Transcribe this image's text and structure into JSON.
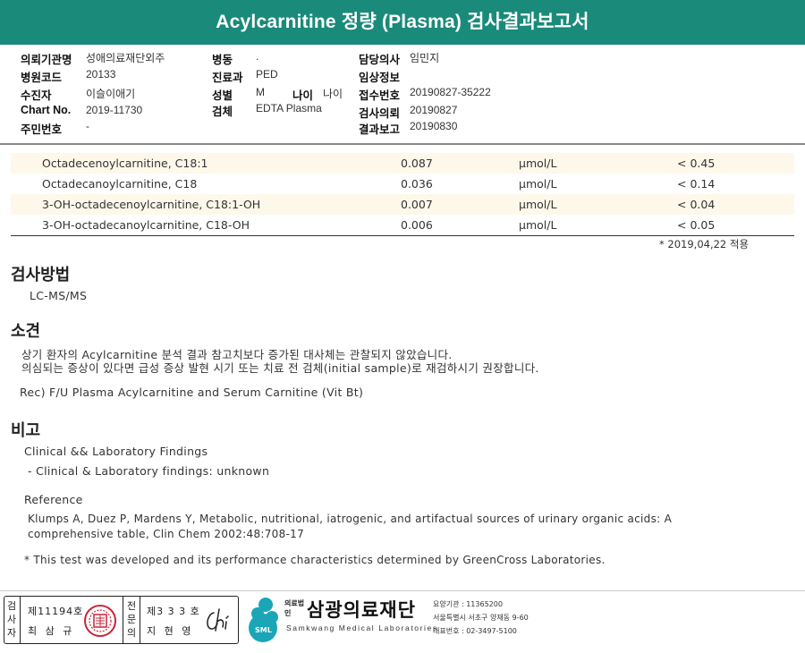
{
  "header": {
    "title": "Acylcarnitine 정량 (Plasma) 검사결과보고서"
  },
  "patient_info": {
    "institution_label": "의뢰기관명",
    "institution": "성애의료재단외주",
    "hospital_code_label": "병원코드",
    "hospital_code": "20133",
    "examinee_label": "수진자",
    "examinee": "이슬이애기",
    "chart_no_label": "Chart No.",
    "chart_no": "2019-11730",
    "resident_no_label": "주민번호",
    "resident_no": "-",
    "ward_label": "병동",
    "ward": ".",
    "department_label": "진료과",
    "department": "PED",
    "sex_label": "성별",
    "sex": "M",
    "age_label": "나이",
    "age": "나이",
    "specimen_label": "검체",
    "specimen": "EDTA Plasma",
    "doctor_label": "담당의사",
    "doctor": "임민지",
    "clinical_info_label": "임상정보",
    "receipt_no_label": "접수번호",
    "receipt_no": "20190827-35222",
    "request_date_label": "검사의뢰",
    "request_date": "20190827",
    "report_date_label": "결과보고",
    "report_date": "20190830"
  },
  "results": [
    {
      "name": "Octadecenoylcarnitine, C18:1",
      "value": "0.087",
      "unit": "μmol/L",
      "reference": "< 0.45"
    },
    {
      "name": "Octadecanoylcarnitine, C18",
      "value": "0.036",
      "unit": "μmol/L",
      "reference": "< 0.14"
    },
    {
      "name": "3-OH-octadecenoylcarnitine, C18:1-OH",
      "value": "0.007",
      "unit": "μmol/L",
      "reference": "< 0.04"
    },
    {
      "name": "3-OH-octadecanoylcarnitine, C18-OH",
      "value": "0.006",
      "unit": "μmol/L",
      "reference": "< 0.05"
    }
  ],
  "reference_note": "* 2019,04,22 적용",
  "method": {
    "heading": "검사방법",
    "text": "LC-MS/MS"
  },
  "findings": {
    "heading": "소견",
    "line1": "상기 환자의 Acylcarnitine 분석 결과 참고치보다 증가된 대사체는 관찰되지 않았습니다.",
    "line2": "의심되는 증상이 있다면 급성 증상 발현 시기 또는 치료 전 검체(initial sample)로 재검하시기 권장합니다.",
    "rec": "Rec) F/U Plasma Acylcarnitine and Serum Carnitine (Vit Bt)"
  },
  "remarks": {
    "heading": "비고",
    "clinical_title": "Clinical && Laboratory Findings",
    "clinical_item": "- Clinical & Laboratory findings: unknown",
    "reference_title": "Reference",
    "reference_line1": "Klumps A, Duez P, Mardens Y, Metabolic, nutritional, iatrogenic, and artifactual sources of urinary organic acids: A",
    "reference_line2": "comprehensive table, Clin Chem 2002:48:708-17",
    "disclaimer": "* This test was developed and its performance characteristics determined by GreenCross Laboratories."
  },
  "signatures": {
    "inspector_label": "검사자",
    "inspector_no": "제11194호",
    "inspector_name": "최 삼 규",
    "specialist_label": "전문의",
    "specialist_no": "제3 3 3 호",
    "specialist_name": "지 현 영"
  },
  "corporation": {
    "tag": "의료법인",
    "name": "삼광의료재단",
    "sub": "Samkwang Medical Laboratories",
    "logo_text": "SML",
    "code": "요양기관 : 11365200",
    "address": "서울특별시 서초구 양재동 9-60",
    "phone": "대표번호 : 02-3497-5100"
  }
}
